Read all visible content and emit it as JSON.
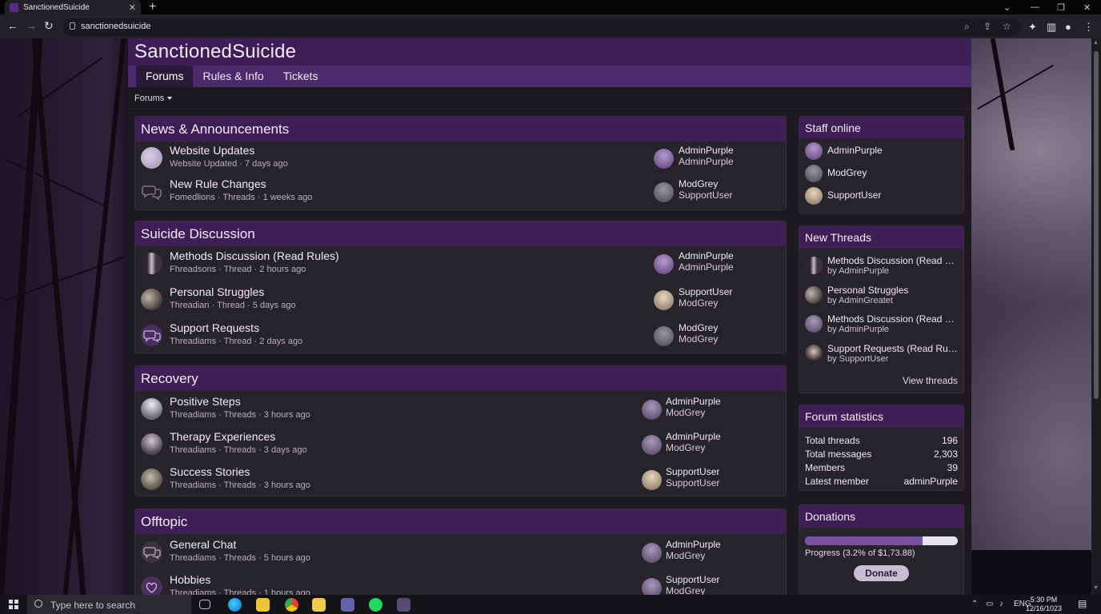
{
  "browser": {
    "tab_title": "SanctionedSuicide",
    "tab_close": "✕",
    "new_tab": "+",
    "url": "sanctionedsuicide"
  },
  "site": {
    "logo": "SanctionedSuicide",
    "nav": [
      "Forums",
      "Rules & Info",
      "Tickets"
    ],
    "subnav": "Forums"
  },
  "categories": [
    {
      "title": "News & Announcements",
      "nodes": [
        {
          "title": "Website Updates",
          "meta": "Website Updated · 7 days ago",
          "user1": "AdminPurple",
          "user2": "AdminPurple"
        },
        {
          "title": "New Rule Changes",
          "meta": "Fomedlions  ·  Threads  · 1 weeks ago",
          "user1": "ModGrey",
          "user2": "SupportUser"
        }
      ]
    },
    {
      "title": "Suicide Discussion",
      "nodes": [
        {
          "title": "Methods Discussion (Read Rules)",
          "meta": "Fhreadsons  ·  Thread  · 2 hours ago",
          "user1": "AdminPurple",
          "user2": "AdminPurple"
        },
        {
          "title": "Personal Struggles",
          "meta": "Threadian  ·  Thread  · 5 days ago",
          "user1": "SupportUser",
          "user2": "ModGrey"
        },
        {
          "title": "Support Requests",
          "meta": "Threadiams  ·  Thread  · 2 days ago",
          "user1": "ModGrey",
          "user2": "ModGrey"
        }
      ]
    },
    {
      "title": "Recovery",
      "nodes": [
        {
          "title": "Positive Steps",
          "meta": "Threadiams  ·  Threads  · 3 hours ago",
          "user1": "AdminPurple",
          "user2": "ModGrey"
        },
        {
          "title": "Therapy Experiences",
          "meta": "Threadiams  ·  Threads  · 3 days ago",
          "user1": "AdminPurple",
          "user2": "ModGrey"
        },
        {
          "title": "Success Stories",
          "meta": "Threadiams  ·  Threads  · 3 hours ago",
          "user1": "SupportUser",
          "user2": "SupportUser"
        }
      ]
    },
    {
      "title": "Offtopic",
      "nodes": [
        {
          "title": "General Chat",
          "meta": "Threadiams  ·  Threads  · 5 hours ago",
          "user1": "AdminPurple",
          "user2": "ModGrey"
        },
        {
          "title": "Hobbies",
          "meta": "Threadiams  ·  Threads  · 1 hours ago",
          "user1": "SupportUser",
          "user2": "ModGrey"
        }
      ]
    }
  ],
  "sidebar": {
    "staff": {
      "title": "Staff online",
      "users": [
        "AdminPurple",
        "ModGrey",
        "SupportUser"
      ]
    },
    "new_threads": {
      "title": "New Threads",
      "items": [
        {
          "title": "Methods Discussion (Read Rul...",
          "by": "by AdminPurple"
        },
        {
          "title": "Personal Struggles",
          "by": "by AdminGreatet"
        },
        {
          "title": "Methods Discussion (Read Rule...",
          "by": "by AdminPurple"
        },
        {
          "title": "Support Requests (Read Rules) ...",
          "by": "by SupportUser"
        }
      ],
      "view_link": "View threads"
    },
    "stats": {
      "title": "Forum statistics",
      "rows": [
        {
          "k": "Total threads",
          "v": "196"
        },
        {
          "k": "Total messages",
          "v": "2,303"
        },
        {
          "k": "Members",
          "v": "39"
        },
        {
          "k": "Latest member",
          "v": "adminPurple"
        }
      ]
    },
    "donations": {
      "title": "Donations",
      "progress_fraction": 0.77,
      "progress_text": "Progress (3.2% of $1,73.88)",
      "button": "Donate"
    }
  },
  "taskbar": {
    "search_placeholder": "Type here to search",
    "lang": "ENG",
    "time": "5:30 PM",
    "date": "12/16/1023"
  },
  "colors": {
    "accent": "#3f1e58",
    "nav": "#4d2a6c",
    "panel": "#26232b"
  }
}
